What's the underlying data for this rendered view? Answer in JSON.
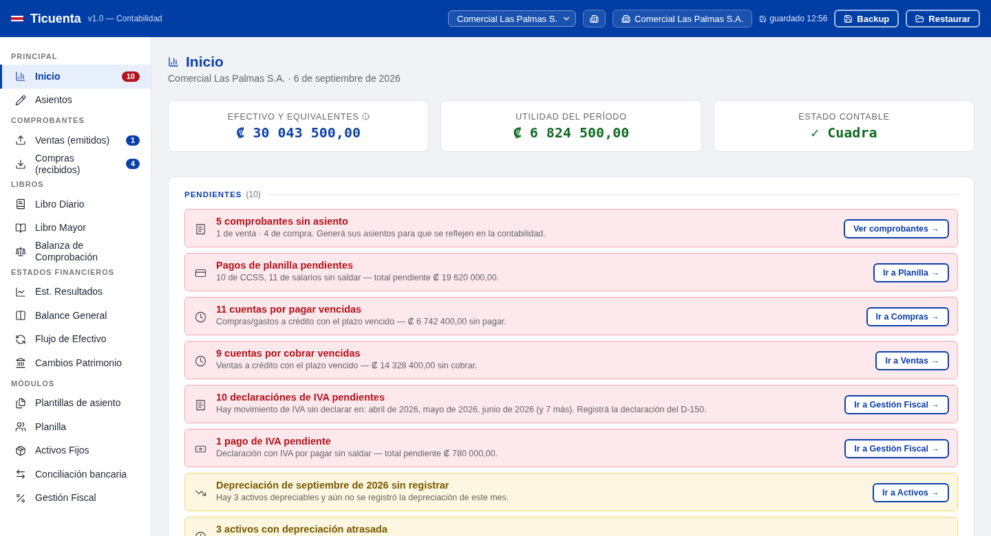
{
  "header": {
    "brand": "Ticuenta",
    "version": "v1.0 — Contabilidad",
    "company_select": "Comercial Las Palmas S.",
    "company_label": "Comercial Las Palmas S.A.",
    "saved": "guardado 12:56",
    "buttons": [
      "Backup",
      "Restaurar"
    ]
  },
  "sidebar": [
    {
      "section": "PRINCIPAL",
      "items": [
        {
          "label": "Inicio",
          "selected": true,
          "badge": {
            "text": "10",
            "color": "#b5121b"
          }
        },
        {
          "label": "Asientos",
          "selected": false
        }
      ]
    },
    {
      "section": "COMPROBANTES",
      "items": [
        {
          "label": "Ventas (emitidos)",
          "selected": false,
          "badge": {
            "text": "1",
            "color": "#0b3fa8"
          }
        },
        {
          "label": "Compras (recibidos)",
          "selected": false,
          "badge": {
            "text": "4",
            "color": "#0b3fa8"
          }
        }
      ]
    },
    {
      "section": "LIBROS",
      "items": [
        {
          "label": "Libro Diario",
          "selected": false
        },
        {
          "label": "Libro Mayor",
          "selected": false
        },
        {
          "label": "Balanza de Comprobación",
          "selected": false
        }
      ]
    },
    {
      "section": "ESTADOS FINANCIEROS",
      "items": [
        {
          "label": "Est. Resultados",
          "selected": false
        },
        {
          "label": "Balance General",
          "selected": false
        },
        {
          "label": "Flujo de Efectivo",
          "selected": false
        },
        {
          "label": "Cambios Patrimonio",
          "selected": false
        }
      ]
    },
    {
      "section": "MÓDULOS",
      "items": [
        {
          "label": "Plantillas de asiento",
          "selected": false
        },
        {
          "label": "Planilla",
          "selected": false
        },
        {
          "label": "Activos Fijos",
          "selected": false
        },
        {
          "label": "Conciliación bancaria",
          "selected": false
        },
        {
          "label": "Gestión Fiscal",
          "selected": false
        }
      ]
    }
  ],
  "page": {
    "title": "Inicio",
    "subtitle": "Comercial Las Palmas S.A. · 6 de septiembre de 2026"
  },
  "stats": [
    {
      "label": "EFECTIVO Y EQUIVALENTES",
      "value": "₡ 30 043 500,00",
      "kind": "info",
      "has_info": true
    },
    {
      "label": "UTILIDAD DEL PERÍODO",
      "value": "₡ 6 824 500,00",
      "kind": "good",
      "has_info": false
    },
    {
      "label": "ESTADO CONTABLE",
      "value": "✓ Cuadra",
      "kind": "good",
      "has_info": false
    }
  ],
  "pending": {
    "title": "PENDIENTES",
    "count": "(10)",
    "items": [
      {
        "kind": "danger",
        "title": "5 comprobantes sin asiento",
        "detail": "1 de venta · 4 de compra. Generá sus asientos para que se reflejen en la contabilidad.",
        "action": "Ver comprobantes →"
      },
      {
        "kind": "danger",
        "title": "Pagos de planilla pendientes",
        "detail": "10 de CCSS, 11 de salarios sin saldar — total pendiente ₡ 19 620 000,00.",
        "action": "Ir a Planilla →"
      },
      {
        "kind": "danger",
        "title": "11 cuentas por pagar vencidas",
        "detail": "Compras/gastos a crédito con el plazo vencido — ₡ 6 742 400,00 sin pagar.",
        "action": "Ir a Compras →"
      },
      {
        "kind": "danger",
        "title": "9 cuentas por cobrar vencidas",
        "detail": "Ventas a crédito con el plazo vencido — ₡ 14 328 400,00 sin cobrar.",
        "action": "Ir a Ventas →"
      },
      {
        "kind": "danger",
        "title": "10 declaraciónes de IVA pendientes",
        "detail": "Hay movimiento de IVA sin declarar en: abril de 2026, mayo de 2026, junio de 2026 (y 7 más). Registrá la declaración del D-150.",
        "action": "Ir a Gestión Fiscal →"
      },
      {
        "kind": "danger",
        "title": "1 pago de IVA pendiente",
        "detail": "Declaración con IVA por pagar sin saldar — total pendiente ₡ 780 000,00.",
        "action": "Ir a Gestión Fiscal →"
      },
      {
        "kind": "warning",
        "title": "Depreciación de septiembre de 2026 sin registrar",
        "detail": "Hay 3 activos depreciables y aún no se registró la depreciación de este mes.",
        "action": "Ir a Activos →"
      },
      {
        "kind": "warning",
        "title": "3 activos con depreciación atrasada"
      }
    ]
  }
}
